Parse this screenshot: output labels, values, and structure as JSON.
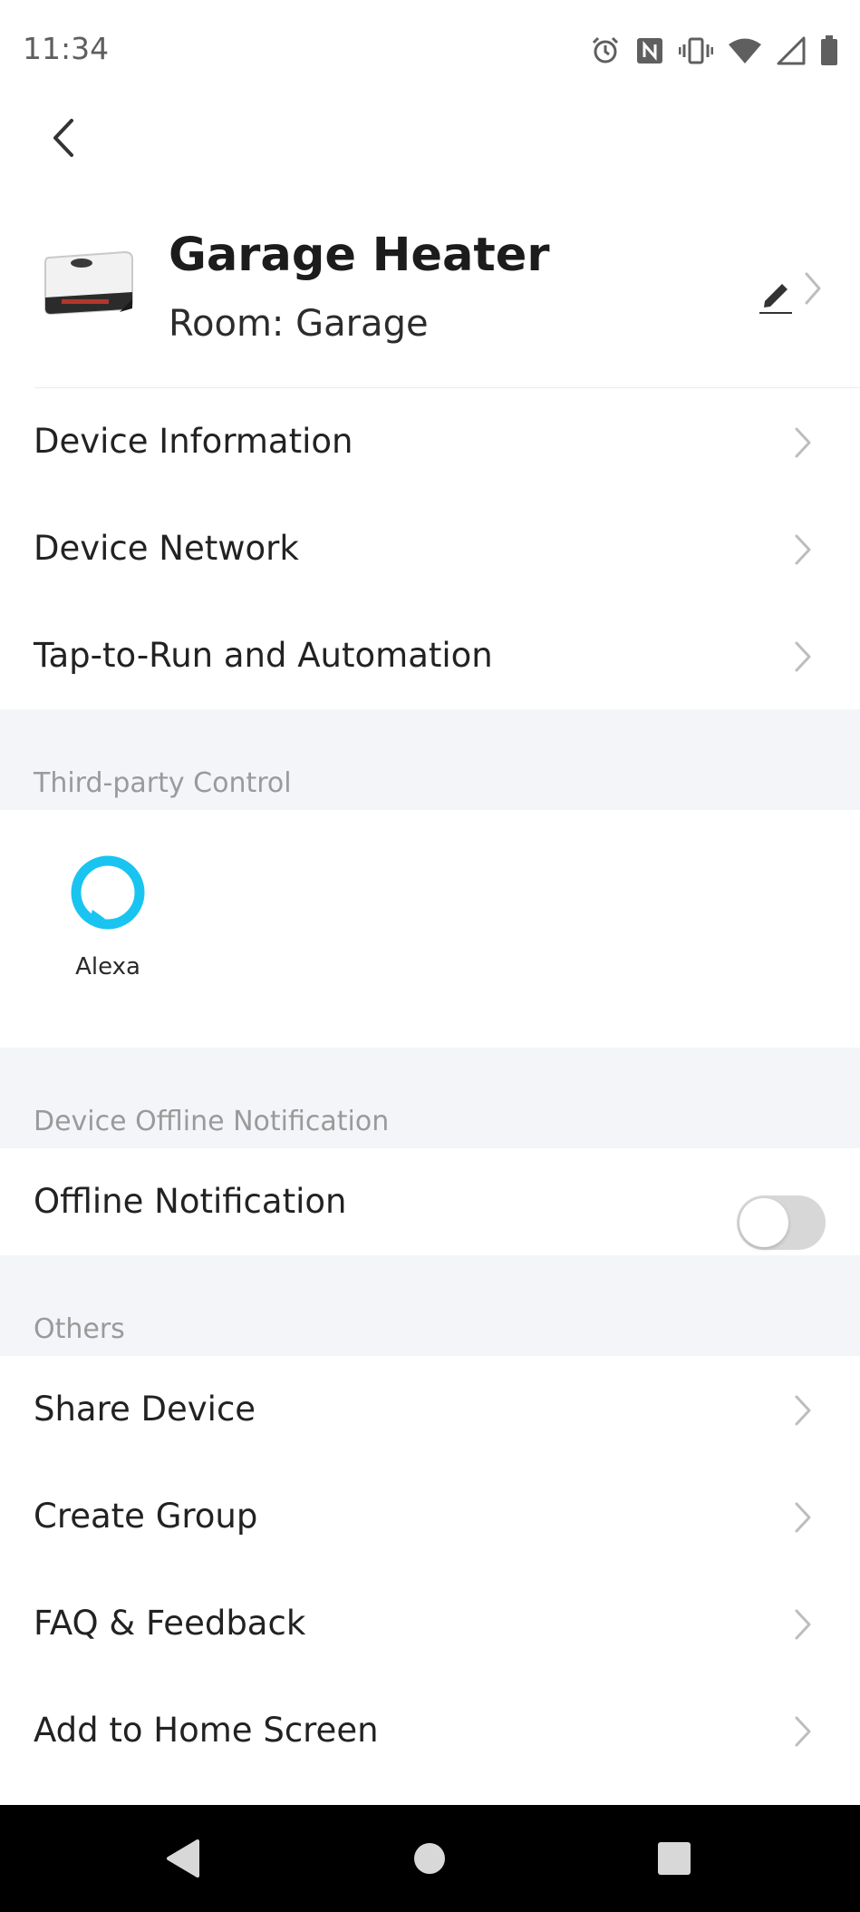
{
  "status_bar": {
    "time": "11:34",
    "icons": [
      "alarm-icon",
      "nfc-icon",
      "vibrate-icon",
      "wifi-icon",
      "signal-icon",
      "battery-icon"
    ]
  },
  "header": {
    "device_name": "Garage Heater",
    "room": "Room: Garage"
  },
  "menu_items": [
    {
      "label": "Device Information"
    },
    {
      "label": "Device Network"
    },
    {
      "label": "Tap-to-Run and Automation"
    }
  ],
  "third_party": {
    "section_title": "Third-party Control",
    "services": [
      {
        "label": "Alexa",
        "icon": "alexa-icon",
        "color": "#1ac4f0"
      }
    ]
  },
  "offline": {
    "section_title": "Device Offline Notification",
    "label": "Offline Notification",
    "enabled": false
  },
  "others": {
    "section_title": "Others",
    "items": [
      {
        "label": "Share Device"
      },
      {
        "label": "Create Group"
      },
      {
        "label": "FAQ & Feedback"
      },
      {
        "label": "Add to Home Screen"
      }
    ]
  },
  "nav_bar": {
    "buttons": [
      "back-icon",
      "home-icon",
      "recents-icon"
    ]
  }
}
